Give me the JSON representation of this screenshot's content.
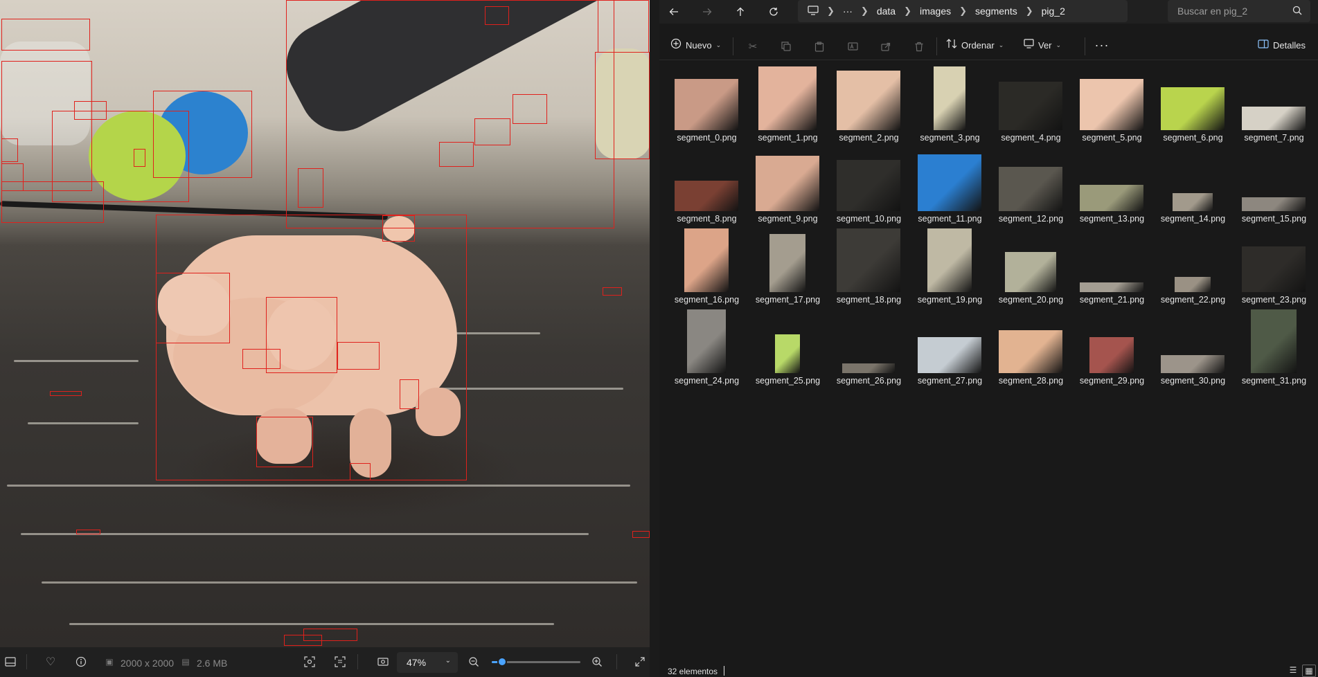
{
  "viewer": {
    "dimensions": "2000 x 2000",
    "file_size": "2.6 MB",
    "zoom": "47%",
    "zoom_level_fraction": 0.08,
    "annotation_color": "#e0211c"
  },
  "explorer": {
    "breadcrumbs": [
      "data",
      "images",
      "segments",
      "pig_2"
    ],
    "search_placeholder": "Buscar en pig_2",
    "commands": {
      "new": "Nuevo",
      "sort": "Ordenar",
      "view": "Ver",
      "details": "Detalles"
    },
    "files": [
      {
        "name": "segment_0.png",
        "color": "#c99a86"
      },
      {
        "name": "segment_1.png",
        "color": "#e3b39c"
      },
      {
        "name": "segment_2.png",
        "color": "#e4bfa6"
      },
      {
        "name": "segment_3.png",
        "color": "#d8d1b2"
      },
      {
        "name": "segment_4.png",
        "color": "#2b2a26"
      },
      {
        "name": "segment_5.png",
        "color": "#ecc5ad"
      },
      {
        "name": "segment_6.png",
        "color": "#b9d44d"
      },
      {
        "name": "segment_7.png",
        "color": "#d6d1c6"
      },
      {
        "name": "segment_8.png",
        "color": "#7a4033"
      },
      {
        "name": "segment_9.png",
        "color": "#d9aa92"
      },
      {
        "name": "segment_10.png",
        "color": "#2f2e2b"
      },
      {
        "name": "segment_11.png",
        "color": "#2b7fd1"
      },
      {
        "name": "segment_12.png",
        "color": "#5a574f"
      },
      {
        "name": "segment_13.png",
        "color": "#9a9a7a"
      },
      {
        "name": "segment_14.png",
        "color": "#a29a8c"
      },
      {
        "name": "segment_15.png",
        "color": "#8d877f"
      },
      {
        "name": "segment_16.png",
        "color": "#dca488"
      },
      {
        "name": "segment_17.png",
        "color": "#a49d8f"
      },
      {
        "name": "segment_18.png",
        "color": "#3d3b37"
      },
      {
        "name": "segment_19.png",
        "color": "#bfb9a4"
      },
      {
        "name": "segment_20.png",
        "color": "#b2b19a"
      },
      {
        "name": "segment_21.png",
        "color": "#a39d92"
      },
      {
        "name": "segment_22.png",
        "color": "#9a9184"
      },
      {
        "name": "segment_23.png",
        "color": "#2e2c29"
      },
      {
        "name": "segment_24.png",
        "color": "#8a8782"
      },
      {
        "name": "segment_25.png",
        "color": "#b8d968"
      },
      {
        "name": "segment_26.png",
        "color": "#7a746a"
      },
      {
        "name": "segment_27.png",
        "color": "#c5ccd2"
      },
      {
        "name": "segment_28.png",
        "color": "#e2b391"
      },
      {
        "name": "segment_29.png",
        "color": "#a5544e"
      },
      {
        "name": "segment_30.png",
        "color": "#9c948a"
      },
      {
        "name": "segment_31.png",
        "color": "#4f5a47"
      }
    ],
    "status": "32 elementos"
  }
}
